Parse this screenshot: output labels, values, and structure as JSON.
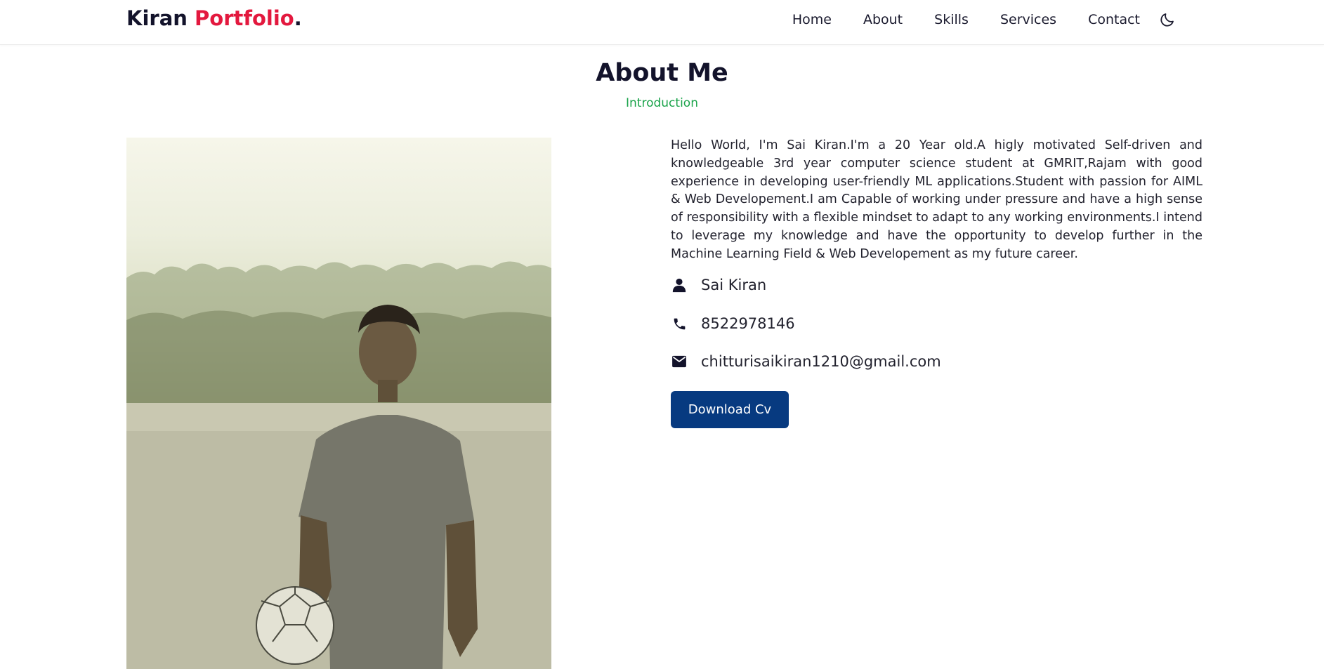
{
  "header": {
    "logo_main": "Kiran",
    "logo_accent": "Portfolio",
    "logo_dot": ".",
    "nav": [
      "Home",
      "About",
      "Skills",
      "Services",
      "Contact"
    ],
    "theme_icon": "moon-icon"
  },
  "about": {
    "title": "About Me",
    "subtitle": "Introduction",
    "description": "Hello World, I'm Sai Kiran.I'm a 20 Year old.A higly motivated Self-driven and knowledgeable 3rd year computer science student at GMRIT,Rajam with good experience in developing user-friendly ML applications.Student with passion for AIML & Web Developement.I am Capable of working under pressure and have a high sense of responsibility with a flexible mindset to adapt to any working environments.I intend to leverage my knowledge and have the opportunity to develop further in the Machine Learning Field & Web Developement as my future career.",
    "name": "Sai Kiran",
    "phone": "8522978146",
    "email": "chitturisaikiran1210@gmail.com",
    "cv_button": "Download Cv",
    "icons": {
      "name": "user-icon",
      "phone": "phone-icon",
      "email": "mail-icon"
    }
  },
  "colors": {
    "accent": "#e3183e",
    "subtitle": "#1aa34a",
    "button": "#073a80",
    "text": "#13132b"
  }
}
